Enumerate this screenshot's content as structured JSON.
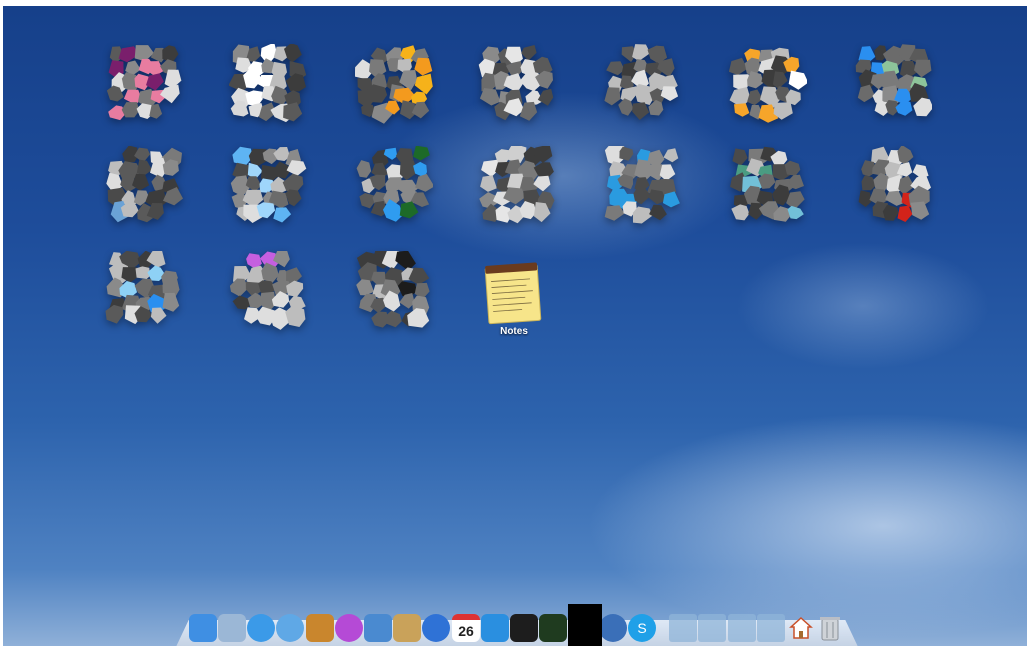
{
  "launchpad": {
    "apps": [
      {
        "row": 0,
        "col": 0,
        "colors": [
          "#e87ca0",
          "#7a1f6c"
        ],
        "label": ""
      },
      {
        "row": 0,
        "col": 1,
        "colors": [
          "#ffffff",
          "#d8d8d8"
        ],
        "label": ""
      },
      {
        "row": 0,
        "col": 2,
        "colors": [
          "#f39a1e",
          "#f6b21a"
        ],
        "label": ""
      },
      {
        "row": 0,
        "col": 3,
        "colors": [
          "#8fb2e6",
          "#e6e6e6"
        ],
        "label": ""
      },
      {
        "row": 0,
        "col": 4,
        "colors": [
          "#e2e2e2",
          "#bdbdbd"
        ],
        "label": ""
      },
      {
        "row": 0,
        "col": 5,
        "colors": [
          "#f6a52a",
          "#ffffff"
        ],
        "label": ""
      },
      {
        "row": 0,
        "col": 6,
        "colors": [
          "#2a8ff0",
          "#8dc49a"
        ],
        "label": ""
      },
      {
        "row": 1,
        "col": 0,
        "colors": [
          "#f3b52a",
          "#6aa2d6"
        ],
        "label": ""
      },
      {
        "row": 1,
        "col": 1,
        "colors": [
          "#5eb4f3",
          "#9fd6fb"
        ],
        "label": ""
      },
      {
        "row": 1,
        "col": 2,
        "colors": [
          "#2f9cf0",
          "#1d6a28"
        ],
        "label": ""
      },
      {
        "row": 1,
        "col": 3,
        "colors": [
          "#e6e6e6",
          "#cfcfcf"
        ],
        "label": ""
      },
      {
        "row": 1,
        "col": 4,
        "colors": [
          "#e57d2a",
          "#2a9be0"
        ],
        "label": ""
      },
      {
        "row": 1,
        "col": 5,
        "colors": [
          "#72c0d8",
          "#4a9c82"
        ],
        "label": ""
      },
      {
        "row": 1,
        "col": 6,
        "colors": [
          "#d2231a",
          "#e0e0e0"
        ],
        "label": ""
      },
      {
        "row": 2,
        "col": 0,
        "colors": [
          "#2a8ff0",
          "#8ed1f5"
        ],
        "label": ""
      },
      {
        "row": 2,
        "col": 1,
        "colors": [
          "#c55fe0",
          "#ecb2f3"
        ],
        "label": ""
      },
      {
        "row": 2,
        "col": 2,
        "colors": [
          "#f1f1f1",
          "#1c1c1c"
        ],
        "label": ""
      }
    ],
    "notes": {
      "label": "Notes"
    }
  },
  "dock": {
    "items": [
      {
        "name": "finder",
        "color": "#3f8fe3"
      },
      {
        "name": "preview",
        "color": "#9bb7d6"
      },
      {
        "name": "messages",
        "color": "#3b9ae8"
      },
      {
        "name": "safari",
        "color": "#5fa8e6"
      },
      {
        "name": "package",
        "color": "#c9862d"
      },
      {
        "name": "flower",
        "color": "#b54ad6"
      },
      {
        "name": "xcode",
        "color": "#4a8ad0"
      },
      {
        "name": "trash-can-app",
        "color": "#c9a25a"
      },
      {
        "name": "itunes",
        "color": "#2f72d6"
      },
      {
        "name": "calendar",
        "color": "#ffffff",
        "text": "26"
      },
      {
        "name": "twitter",
        "color": "#2a8fe0"
      },
      {
        "name": "terminal",
        "color": "#1d1d1d"
      },
      {
        "name": "activity-monitor",
        "color": "#1f3b1f"
      },
      {
        "name": "quicktime",
        "color": "#3a6fb8"
      },
      {
        "name": "skype",
        "color": "#1fa0e8",
        "text": "S"
      },
      {
        "name": "folder-applications",
        "color": "#8fb4d8"
      },
      {
        "name": "folder-tools",
        "color": "#8fb4d8"
      },
      {
        "name": "folder-downloads",
        "color": "#8fb4d8"
      },
      {
        "name": "folder-documents",
        "color": "#8fb4d8"
      },
      {
        "name": "home",
        "color": "#f4f4f4"
      },
      {
        "name": "trash",
        "color": "#d0d4da"
      }
    ]
  }
}
